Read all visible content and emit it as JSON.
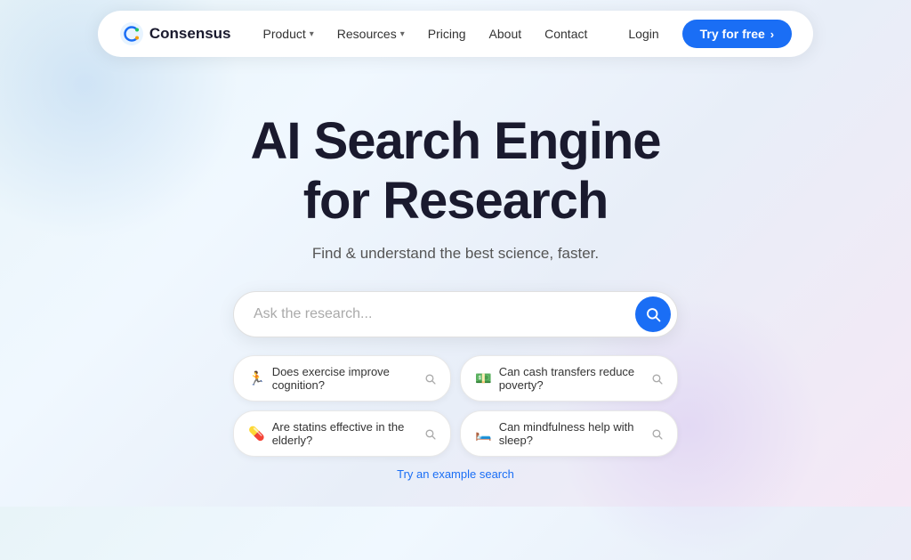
{
  "navbar": {
    "logo_text": "Consensus",
    "nav_items": [
      {
        "label": "Product",
        "has_dropdown": true
      },
      {
        "label": "Resources",
        "has_dropdown": true
      },
      {
        "label": "Pricing",
        "has_dropdown": false
      },
      {
        "label": "About",
        "has_dropdown": false
      },
      {
        "label": "Contact",
        "has_dropdown": false
      }
    ],
    "login_label": "Login",
    "try_label": "Try for free",
    "try_arrow": "›"
  },
  "hero": {
    "title_line1": "AI Search Engine",
    "title_line2": "for Research",
    "subtitle": "Find & understand the best science, faster.",
    "search_placeholder": "Ask the research...",
    "search_icon": "🔍",
    "example_chips": [
      {
        "emoji": "🏃",
        "text": "Does exercise improve cognition?",
        "id": "chip-exercise"
      },
      {
        "emoji": "💵",
        "text": "Can cash transfers reduce poverty?",
        "id": "chip-cash"
      },
      {
        "emoji": "💊",
        "text": "Are statins effective in the elderly?",
        "id": "chip-statins"
      },
      {
        "emoji": "🛏️",
        "text": "Can mindfulness help with sleep?",
        "id": "chip-mindfulness"
      }
    ],
    "try_example_label": "Try an example search"
  },
  "colors": {
    "accent": "#1a6ef5",
    "text_primary": "#1a1a2e",
    "text_muted": "#555"
  }
}
